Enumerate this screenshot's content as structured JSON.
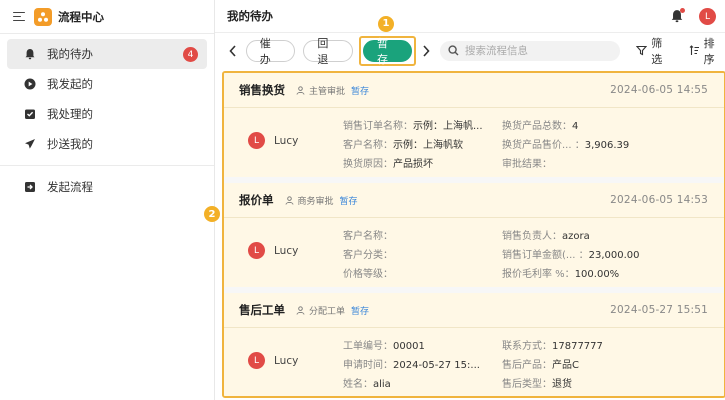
{
  "app": {
    "title": "流程中心",
    "logo_color": "#f39c28"
  },
  "sidebar": {
    "items": [
      {
        "label": "我的待办",
        "icon": "bell-icon",
        "badge": "4",
        "active": true
      },
      {
        "label": "我发起的",
        "icon": "play-circle-icon"
      },
      {
        "label": "我处理的",
        "icon": "check-tray-icon"
      },
      {
        "label": "抄送我的",
        "icon": "send-icon"
      }
    ],
    "start_flow": {
      "label": "发起流程",
      "icon": "start-flow-icon"
    }
  },
  "header": {
    "title": "我的待办",
    "user_initial": "L"
  },
  "toolbar": {
    "urge_label": "催办",
    "return_label": "回退",
    "save_label": "暂存",
    "search_placeholder": "搜索流程信息",
    "filter_label": "筛选",
    "sort_label": "排序"
  },
  "annotations": {
    "marker_1": "1",
    "marker_2": "2"
  },
  "cards": [
    {
      "title": "销售换货",
      "node": "主管审批",
      "status": "暂存",
      "time": "2024-06-05 14:55",
      "person_initial": "L",
      "person": "Lucy",
      "fields": [
        {
          "k": "销售订单名称：",
          "v": "示例：上海帆..."
        },
        {
          "k": "换货产品总数：",
          "v": "4"
        },
        {
          "k": "客户名称：",
          "v": "示例：上海帆软"
        },
        {
          "k": "换货产品售价... ：",
          "v": "3,906.39"
        },
        {
          "k": "换货原因：",
          "v": "产品损坏"
        },
        {
          "k": "审批结果：",
          "v": ""
        }
      ]
    },
    {
      "title": "报价单",
      "node": "商务审批",
      "status": "暂存",
      "time": "2024-06-05 14:53",
      "person_initial": "L",
      "person": "Lucy",
      "fields": [
        {
          "k": "客户名称：",
          "v": ""
        },
        {
          "k": "销售负责人：",
          "v": "azora"
        },
        {
          "k": "客户分类：",
          "v": ""
        },
        {
          "k": "销售订单金额(... ：",
          "v": "23,000.00"
        },
        {
          "k": "价格等级：",
          "v": ""
        },
        {
          "k": "报价毛利率 %：",
          "v": "100.00%"
        }
      ]
    },
    {
      "title": "售后工单",
      "node": "分配工单",
      "status": "暂存",
      "time": "2024-05-27 15:51",
      "person_initial": "L",
      "person": "Lucy",
      "fields": [
        {
          "k": "工单编号：",
          "v": "00001"
        },
        {
          "k": "联系方式：",
          "v": "17877777"
        },
        {
          "k": "申请时间：",
          "v": "2024-05-27 15:..."
        },
        {
          "k": "售后产品：",
          "v": "产品C"
        },
        {
          "k": "姓名：",
          "v": "alia"
        },
        {
          "k": "售后类型：",
          "v": "退货"
        }
      ]
    }
  ],
  "colors": {
    "accent_green": "#1aa37c",
    "badge_red": "#e14b46",
    "highlight_orange": "#f0b43e",
    "status_blue": "#3a86d9"
  }
}
